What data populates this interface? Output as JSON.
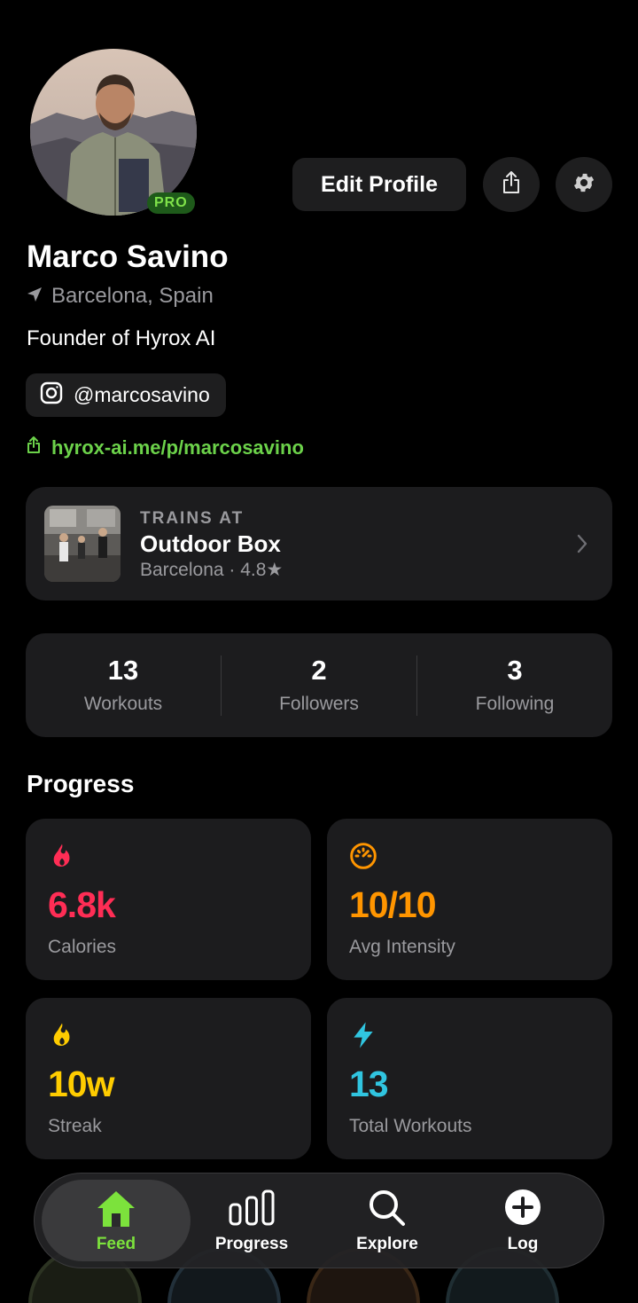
{
  "profile": {
    "name": "Marco Savino",
    "location": "Barcelona, Spain",
    "bio": "Founder of Hyrox AI",
    "instagram": "@marcosavino",
    "link": "hyrox-ai.me/p/marcosavino",
    "badge": "PRO"
  },
  "actions": {
    "edit_label": "Edit Profile"
  },
  "gym": {
    "kicker": "TRAINS AT",
    "name": "Outdoor Box",
    "meta": "Barcelona · 4.8★"
  },
  "stats": [
    {
      "value": "13",
      "label": "Workouts"
    },
    {
      "value": "2",
      "label": "Followers"
    },
    {
      "value": "3",
      "label": "Following"
    }
  ],
  "progress": {
    "title": "Progress",
    "metrics": [
      {
        "value": "6.8k",
        "label": "Calories",
        "color": "#ff2d55",
        "icon": "flame-icon"
      },
      {
        "value": "10/10",
        "label": "Avg Intensity",
        "color": "#ff9500",
        "icon": "speedometer-icon"
      },
      {
        "value": "10w",
        "label": "Streak",
        "color": "#ffcc00",
        "icon": "flame-icon"
      },
      {
        "value": "13",
        "label": "Total Workouts",
        "color": "#30c5e0",
        "icon": "bolt-icon"
      }
    ]
  },
  "nav": {
    "items": [
      {
        "label": "Feed",
        "icon": "home-icon",
        "active": true
      },
      {
        "label": "Progress",
        "icon": "bar-chart-icon"
      },
      {
        "label": "Explore",
        "icon": "search-icon"
      },
      {
        "label": "Log",
        "icon": "plus-circle-icon"
      }
    ],
    "accent": "#7ce23c"
  }
}
